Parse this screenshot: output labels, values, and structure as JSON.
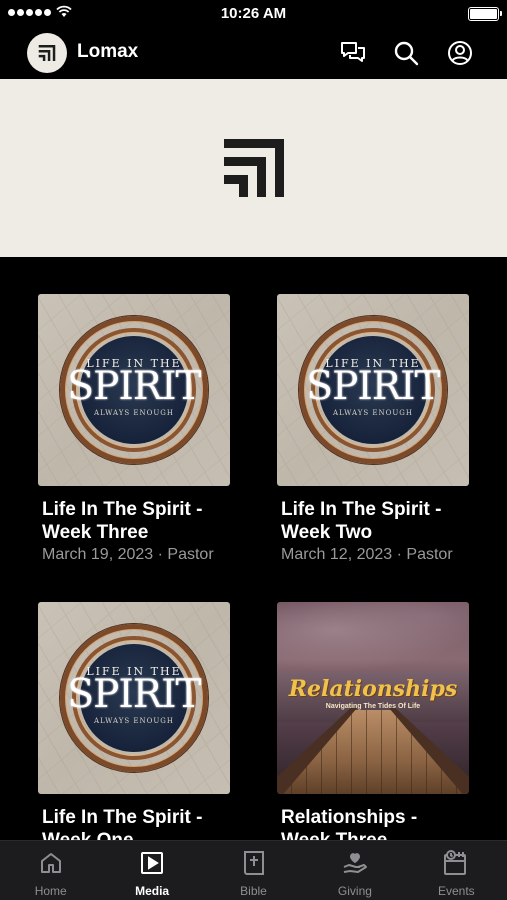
{
  "status_bar": {
    "time": "10:26 AM"
  },
  "app": {
    "name": "Lomax"
  },
  "header_icons": [
    "chat-icon",
    "search-icon",
    "account-icon"
  ],
  "media": {
    "items": [
      {
        "title": "Life In The Spirit - Week Three",
        "meta": "March 19, 2023 · Pastor",
        "art": "spirit"
      },
      {
        "title": "Life In The Spirit - Week Two",
        "meta": "March 12, 2023 · Pastor",
        "art": "spirit"
      },
      {
        "title": "Life In The Spirit - Week One",
        "meta": "",
        "art": "spirit"
      },
      {
        "title": "Relationships - Week Three",
        "meta": "",
        "art": "relationships"
      }
    ],
    "spirit_art": {
      "top": "LIFE IN THE",
      "big": "SPIRIT",
      "sub": "ALWAYS ENOUGH"
    },
    "relationships_art": {
      "title": "Relationships",
      "sub": "Navigating The Tides Of Life"
    }
  },
  "tabs": [
    {
      "label": "Home",
      "icon": "home-icon",
      "active": false
    },
    {
      "label": "Media",
      "icon": "play-icon",
      "active": true
    },
    {
      "label": "Bible",
      "icon": "bible-icon",
      "active": false
    },
    {
      "label": "Giving",
      "icon": "giving-icon",
      "active": false
    },
    {
      "label": "Events",
      "icon": "events-icon",
      "active": false
    }
  ],
  "colors": {
    "banner_bg": "#efece6",
    "tab_bar_bg": "#1c1c1e",
    "meta_text": "#9a9a9a"
  }
}
